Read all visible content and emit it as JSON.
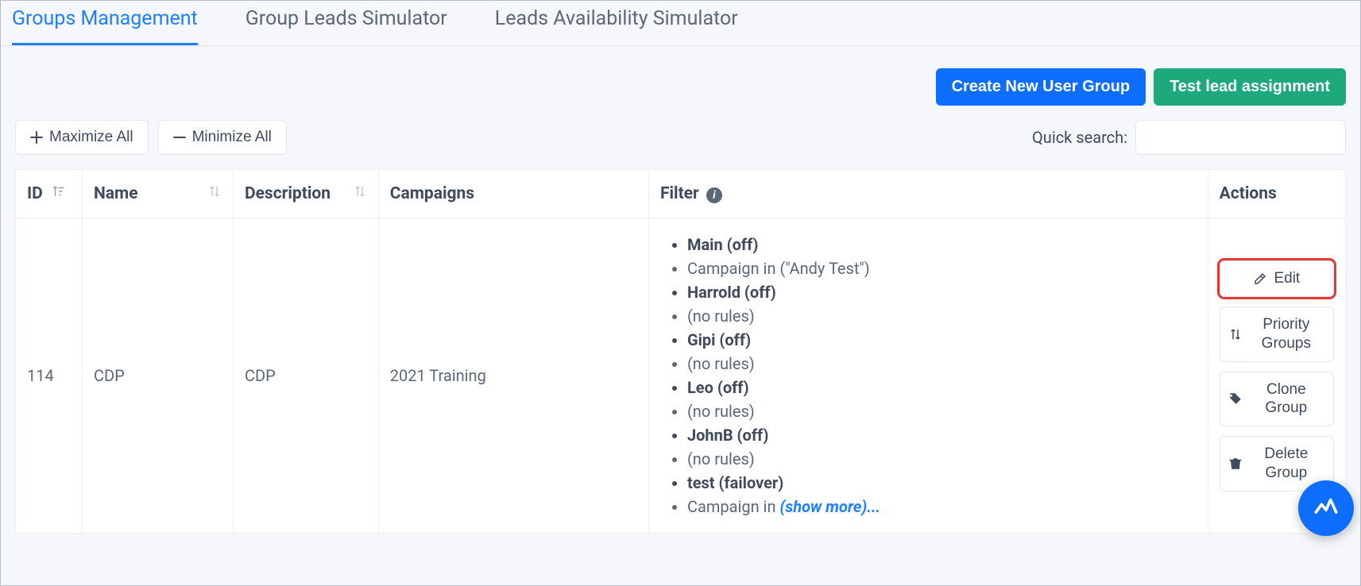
{
  "tabs": [
    {
      "label": "Groups Management",
      "active": true
    },
    {
      "label": "Group Leads Simulator",
      "active": false
    },
    {
      "label": "Leads Availability Simulator",
      "active": false
    }
  ],
  "buttons": {
    "create_group": "Create New User Group",
    "test_lead": "Test lead assignment",
    "maximize_all": "Maximize All",
    "minimize_all": "Minimize All"
  },
  "search": {
    "label": "Quick search:",
    "value": ""
  },
  "columns": {
    "id": "ID",
    "name": "Name",
    "description": "Description",
    "campaigns": "Campaigns",
    "filter": "Filter",
    "actions": "Actions"
  },
  "row": {
    "id": "114",
    "name": "CDP",
    "description": "CDP",
    "campaigns": "2021 Training",
    "filters": [
      {
        "text": "Main (off)",
        "strong": true
      },
      {
        "text": "Campaign in (\"Andy Test\")",
        "strong": false
      },
      {
        "text": "Harrold (off)",
        "strong": true
      },
      {
        "text": "(no rules)",
        "strong": false
      },
      {
        "text": "Gipi (off)",
        "strong": true
      },
      {
        "text": "(no rules)",
        "strong": false
      },
      {
        "text": "Leo (off)",
        "strong": true
      },
      {
        "text": "(no rules)",
        "strong": false
      },
      {
        "text": "JohnB (off)",
        "strong": true
      },
      {
        "text": "(no rules)",
        "strong": false
      },
      {
        "text": "test (failover)",
        "strong": true
      }
    ],
    "filter_last_prefix": "Campaign in ",
    "filter_show_more": "(show more)...",
    "actions": {
      "edit": "Edit",
      "priority": "Priority Groups",
      "clone": "Clone Group",
      "delete": "Delete Group"
    }
  }
}
